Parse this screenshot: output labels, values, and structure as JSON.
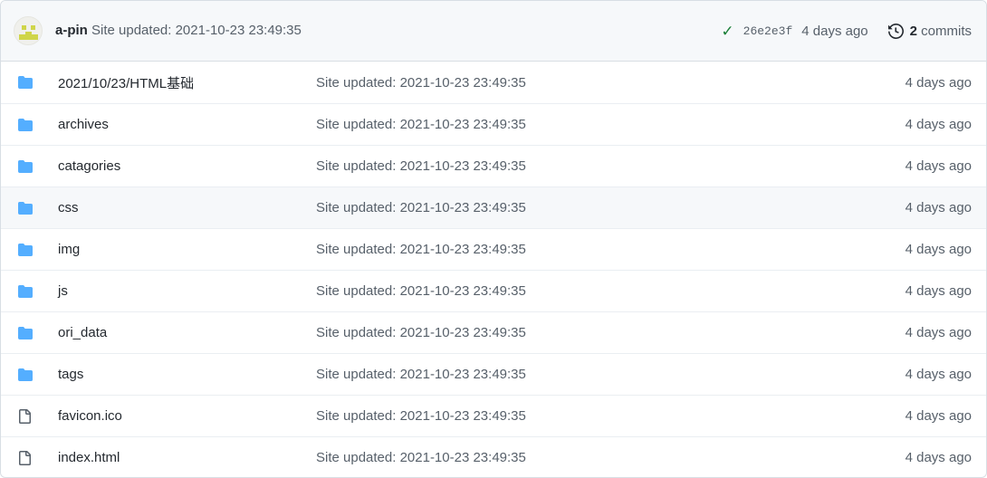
{
  "header": {
    "avatar_icon": "identicon-avatar",
    "author": "a-pin",
    "commit_message": "Site updated: 2021-10-23 23:49:35",
    "status_icon": "check-icon",
    "status_glyph": "✓",
    "commit_sha": "26e2e3f",
    "commit_time": "4 days ago",
    "history_icon": "history-icon",
    "commits_number": "2",
    "commits_label": " commits"
  },
  "colors": {
    "header_bg": "#f6f8fa",
    "border": "#d8dee4",
    "row_border": "#eaeef2",
    "folder_blue": "#54aeff",
    "file_gray": "#57606a",
    "text_primary": "#24292f",
    "text_muted": "#57606a",
    "check_green": "#1a7f37",
    "hover_bg": "#f6f8fa",
    "avatar_accent": "#cfd549"
  },
  "files": [
    {
      "icon": "folder-icon",
      "type": "folder",
      "name": "2021/10/23/HTML基础",
      "message": "Site updated: 2021-10-23 23:49:35",
      "age": "4 days ago",
      "hovered": false
    },
    {
      "icon": "folder-icon",
      "type": "folder",
      "name": "archives",
      "message": "Site updated: 2021-10-23 23:49:35",
      "age": "4 days ago",
      "hovered": false
    },
    {
      "icon": "folder-icon",
      "type": "folder",
      "name": "catagories",
      "message": "Site updated: 2021-10-23 23:49:35",
      "age": "4 days ago",
      "hovered": false
    },
    {
      "icon": "folder-icon",
      "type": "folder",
      "name": "css",
      "message": "Site updated: 2021-10-23 23:49:35",
      "age": "4 days ago",
      "hovered": true
    },
    {
      "icon": "folder-icon",
      "type": "folder",
      "name": "img",
      "message": "Site updated: 2021-10-23 23:49:35",
      "age": "4 days ago",
      "hovered": false
    },
    {
      "icon": "folder-icon",
      "type": "folder",
      "name": "js",
      "message": "Site updated: 2021-10-23 23:49:35",
      "age": "4 days ago",
      "hovered": false
    },
    {
      "icon": "folder-icon",
      "type": "folder",
      "name": "ori_data",
      "message": "Site updated: 2021-10-23 23:49:35",
      "age": "4 days ago",
      "hovered": false
    },
    {
      "icon": "folder-icon",
      "type": "folder",
      "name": "tags",
      "message": "Site updated: 2021-10-23 23:49:35",
      "age": "4 days ago",
      "hovered": false
    },
    {
      "icon": "file-icon",
      "type": "file",
      "name": "favicon.ico",
      "message": "Site updated: 2021-10-23 23:49:35",
      "age": "4 days ago",
      "hovered": false
    },
    {
      "icon": "file-icon",
      "type": "file",
      "name": "index.html",
      "message": "Site updated: 2021-10-23 23:49:35",
      "age": "4 days ago",
      "hovered": false
    }
  ]
}
